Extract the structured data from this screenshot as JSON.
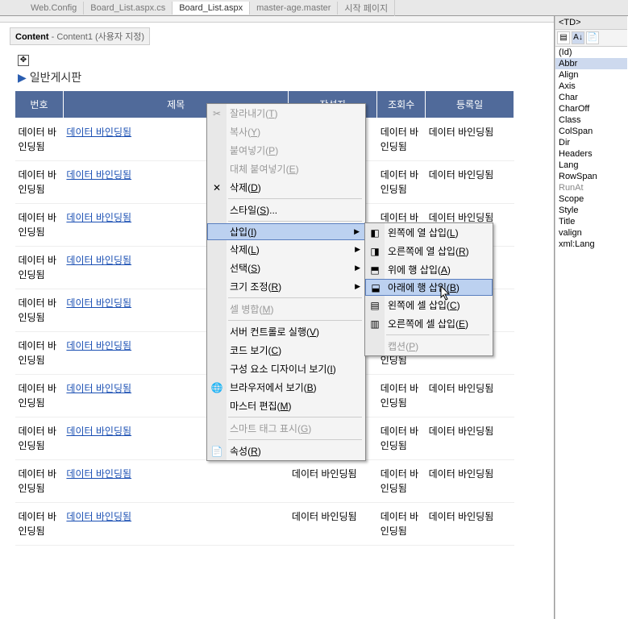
{
  "tabs": [
    "Web.Config",
    "Board_List.aspx.cs",
    "Board_List.aspx",
    "master-age.master",
    "시작 페이지"
  ],
  "activeTab": 2,
  "contentTag": {
    "bold": "Content",
    "rest": " - Content1 (사용자 지정)"
  },
  "boardTitle": "일반게시판",
  "headers": [
    "번호",
    "제목",
    "작성자",
    "조회수",
    "등록일"
  ],
  "cellTextShort": "데이터 바인딩됨",
  "linkText": "데이터 바인딩됨",
  "rows": 10,
  "ctx1": [
    {
      "t": "잘라내기(T)",
      "ico": "✂",
      "dis": true
    },
    {
      "t": "복사(Y)",
      "dis": true
    },
    {
      "t": "붙여넣기(P)",
      "dis": true
    },
    {
      "t": "대체 붙여넣기(E)",
      "dis": true
    },
    {
      "t": "삭제(D)",
      "ico": "✕"
    },
    {
      "sep": true
    },
    {
      "t": "스타일(S)..."
    },
    {
      "sep": true
    },
    {
      "t": "삽입(I)",
      "arrow": true,
      "hov": true
    },
    {
      "t": "삭제(L)",
      "arrow": true
    },
    {
      "t": "선택(S)",
      "arrow": true
    },
    {
      "t": "크기 조정(R)",
      "arrow": true
    },
    {
      "sep": true
    },
    {
      "t": "셀 병합(M)",
      "dis": true
    },
    {
      "sep": true
    },
    {
      "t": "서버 컨트롤로 실행(V)"
    },
    {
      "t": "코드 보기(C)"
    },
    {
      "t": "구성 요소 디자이너 보기(I)"
    },
    {
      "t": "브라우저에서 보기(B)",
      "ico": "🌐"
    },
    {
      "t": "마스터 편집(M)"
    },
    {
      "sep": true
    },
    {
      "t": "스마트 태그 표시(G)",
      "dis": true
    },
    {
      "sep": true
    },
    {
      "t": "속성(R)",
      "ico": "📄"
    }
  ],
  "ctx2": [
    {
      "t": "왼쪽에 열 삽입(L)",
      "ico": "◧"
    },
    {
      "t": "오른쪽에 열 삽입(R)",
      "ico": "◨"
    },
    {
      "t": "위에 행 삽입(A)",
      "ico": "⬒"
    },
    {
      "t": "아래에 행 삽입(B)",
      "ico": "⬓",
      "hov": true
    },
    {
      "t": "왼쪽에 셀 삽입(C)",
      "ico": "▤"
    },
    {
      "t": "오른쪽에 셀 삽입(E)",
      "ico": "▥"
    },
    {
      "sep": true
    },
    {
      "t": "캡션(P)",
      "dis": true
    }
  ],
  "propHead": "<TD>",
  "props": [
    {
      "t": "(Id)"
    },
    {
      "t": "Abbr",
      "sel": true
    },
    {
      "t": "Align"
    },
    {
      "t": "Axis"
    },
    {
      "t": "Char"
    },
    {
      "t": "CharOff"
    },
    {
      "t": "Class"
    },
    {
      "t": "ColSpan"
    },
    {
      "t": "Dir"
    },
    {
      "t": "Headers"
    },
    {
      "t": "Lang"
    },
    {
      "t": "RowSpan"
    },
    {
      "t": "RunAt",
      "gray": true
    },
    {
      "t": "Scope"
    },
    {
      "t": "Style"
    },
    {
      "t": "Title"
    },
    {
      "t": "valign"
    },
    {
      "t": "xml:Lang"
    }
  ]
}
